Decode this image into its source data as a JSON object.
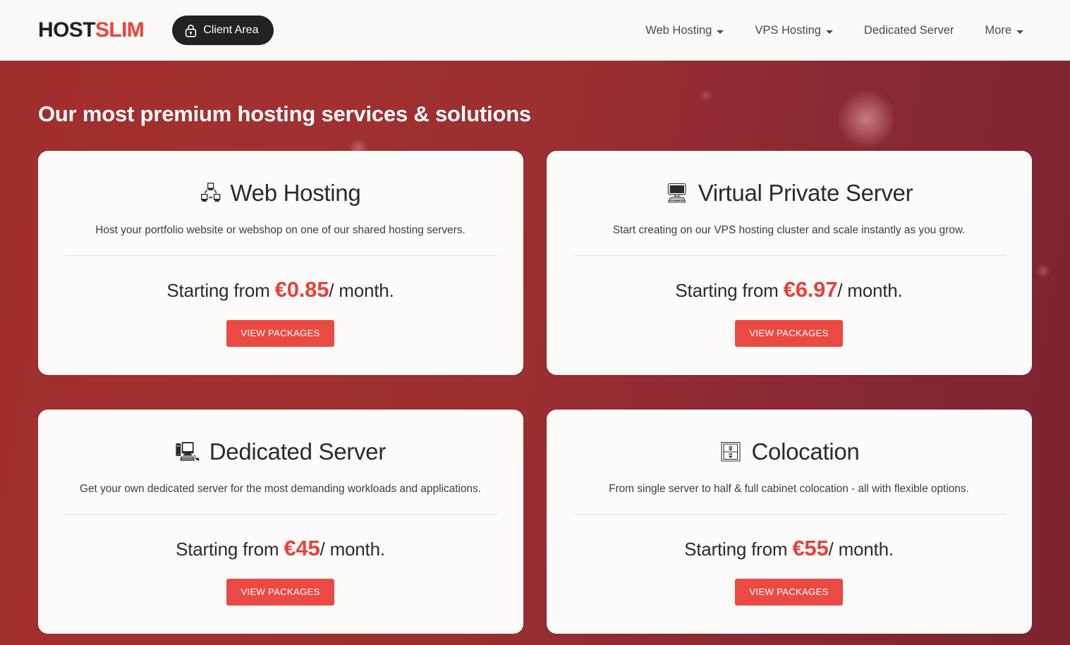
{
  "header": {
    "brand": {
      "first": "HOST",
      "second": "SLIM"
    },
    "client_area_label": "Client Area",
    "lock_icon_name": "lock-icon",
    "nav": [
      {
        "label": "Web Hosting",
        "has_caret": true
      },
      {
        "label": "VPS Hosting",
        "has_caret": true
      },
      {
        "label": "Dedicated Server",
        "has_caret": false
      },
      {
        "label": "More",
        "has_caret": true
      }
    ]
  },
  "hero": {
    "title": "Our most premium hosting services & solutions",
    "cards": [
      {
        "icon": "🖧",
        "icon_name": "router-icon",
        "title": "Web Hosting",
        "description": "Host your portfolio website or webshop on one of our shared hosting servers.",
        "price_prefix": "Starting from ",
        "price_amount": "€0.85",
        "price_period": "/ month.",
        "button_label": "VIEW PACKAGES"
      },
      {
        "icon": "🖥",
        "icon_name": "server-stack-icon",
        "title": "Virtual Private Server",
        "description": "Start creating on our VPS hosting cluster and scale instantly as you grow.",
        "price_prefix": "Starting from ",
        "price_amount": "€6.97",
        "price_period": "/ month.",
        "button_label": "VIEW PACKAGES"
      },
      {
        "icon": "🖳",
        "icon_name": "server-rack-icon",
        "title": "Dedicated Server",
        "description": "Get your own dedicated server for the most demanding workloads and applications.",
        "price_prefix": "Starting from ",
        "price_amount": "€45",
        "price_period": "/ month.",
        "button_label": "VIEW PACKAGES"
      },
      {
        "icon": "🗄",
        "icon_name": "data-center-cabinet-icon",
        "title": "Colocation",
        "description": "From single server to half & full cabinet colocation - all with flexible options.",
        "price_prefix": "Starting from ",
        "price_amount": "€55",
        "price_period": "/ month.",
        "button_label": "VIEW PACKAGES"
      }
    ]
  },
  "colors": {
    "brand_red": "#ef4136",
    "button_red": "#ea4a43",
    "price_red": "#e8413b",
    "hero_gradient_start": "#a02e2c",
    "hero_gradient_end": "#7c2431",
    "card_bg": "#fdfcfb",
    "header_bg": "#fbfaf9",
    "client_area_bg": "#222222"
  }
}
